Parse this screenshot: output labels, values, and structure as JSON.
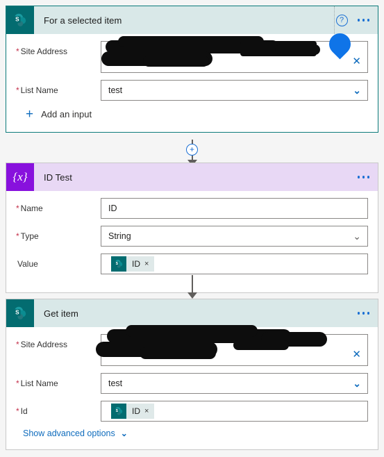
{
  "page": {
    "background": "#f5f5f5",
    "teal": "#036c70",
    "purple": "#8811dd",
    "link_blue": "#0f6cbd",
    "required_red": "#c4314b"
  },
  "cards": [
    {
      "id": "trigger",
      "title": "For a selected item",
      "icon": "sharepoint-icon",
      "help_icon": "help-circle-icon",
      "menu_icon": "ellipsis-icon",
      "fields": [
        {
          "label": "Site Address",
          "required_marker": "*",
          "value": "",
          "redacted": true,
          "control": "clear-x-icon",
          "control_glyph": "✕"
        },
        {
          "label": "List Name",
          "required_marker": "*",
          "value": "test",
          "redacted": false,
          "control": "chevron-down-icon",
          "control_glyph": "⌄"
        }
      ],
      "add_input": {
        "plus_glyph": "+",
        "label": "Add an input"
      }
    },
    {
      "id": "initialize-variable",
      "title": "ID Test",
      "icon": "variable-braces-icon",
      "icon_glyph": "{x}",
      "menu_icon": "ellipsis-icon",
      "fields": [
        {
          "label": "Name",
          "required_marker": "*",
          "value": "ID",
          "control": "none"
        },
        {
          "label": "Type",
          "required_marker": "*",
          "value": "String",
          "control": "chevron-down-icon",
          "control_glyph": "⌄"
        },
        {
          "label": "Value",
          "required_marker": "",
          "token": {
            "icon": "sharepoint-icon",
            "label": "ID",
            "remove_glyph": "×"
          }
        }
      ]
    },
    {
      "id": "get-item",
      "title": "Get item",
      "icon": "sharepoint-icon",
      "menu_icon": "ellipsis-icon",
      "fields": [
        {
          "label": "Site Address",
          "required_marker": "*",
          "value": "",
          "redacted": true,
          "control": "clear-x-icon",
          "control_glyph": "✕"
        },
        {
          "label": "List Name",
          "required_marker": "*",
          "value": "test",
          "redacted": false,
          "control": "chevron-down-icon",
          "control_glyph": "⌄"
        },
        {
          "label": "Id",
          "required_marker": "*",
          "token": {
            "icon": "sharepoint-icon",
            "label": "ID",
            "remove_glyph": "×"
          }
        }
      ],
      "advanced": {
        "label": "Show advanced options",
        "chevron_glyph": "⌄"
      }
    }
  ],
  "connectors": [
    {
      "id": "connector-trigger-to-variable",
      "has_add_button": true,
      "add_glyph": "+"
    },
    {
      "id": "connector-variable-to-getitem",
      "has_add_button": false
    }
  ],
  "cursor": {
    "name": "water-drop-cursor",
    "color": "#0f74e8"
  }
}
